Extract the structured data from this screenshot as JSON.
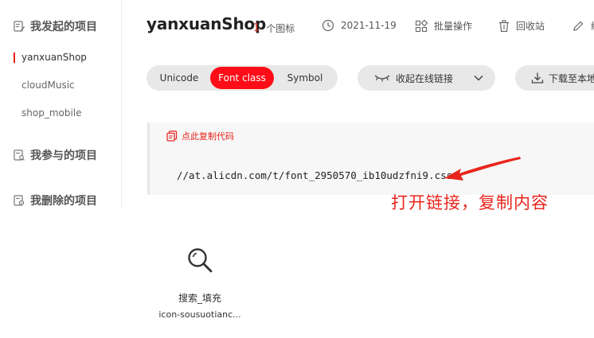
{
  "sidebar": {
    "my_projects": "我发起的项目",
    "projects": [
      {
        "label": "yanxuanShop",
        "active": true
      },
      {
        "label": "cloudMusic",
        "active": false
      },
      {
        "label": "shop_mobile",
        "active": false
      }
    ],
    "joined": "我参与的项目",
    "deleted": "我删除的项目"
  },
  "header": {
    "title": "yanxuanShop",
    "icon_count": "1",
    "icon_count_unit": "个图标",
    "date": "2021-11-19",
    "batch": "批量操作",
    "recycle": "回收站",
    "edit": "编"
  },
  "tabs": {
    "unicode": "Unicode",
    "font_class": "Font class",
    "symbol": "Symbol"
  },
  "actions": {
    "collapse_link": "收起在线链接",
    "download": "下载至本地"
  },
  "code": {
    "copy_label": "点此复制代码",
    "url": "//at.alicdn.com/t/font_2950570_ib10udzfni9.css"
  },
  "annotation": "打开链接，复制内容",
  "icons": [
    {
      "name": "搜索_填充",
      "code": "icon-sousuotianc..."
    }
  ],
  "colors": {
    "accent": "#fe0c17",
    "annotation": "#e8251c"
  }
}
